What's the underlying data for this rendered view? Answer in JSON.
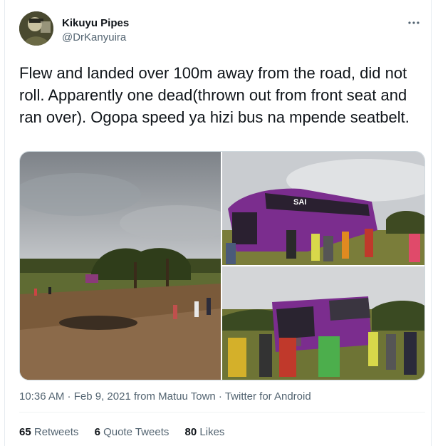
{
  "author": {
    "display_name": "Kikuyu Pipes",
    "handle": "@DrKanyuira"
  },
  "more_icon": "more-horizontal-icon",
  "tweet": {
    "text": "Flew and landed over 100m away from the road, did not roll. Apparently one dead(thrown out from front seat and ran over). Ogopa speed ya hizi bus na mpende seatbelt."
  },
  "photos": [
    {
      "id": "photo-1",
      "subject": "field scene with acacia trees and distant crowd"
    },
    {
      "id": "photo-2",
      "subject": "purple bus on its side with bystanders"
    },
    {
      "id": "photo-3",
      "subject": "purple bus front with crowd"
    }
  ],
  "meta": {
    "time": "10:36 AM",
    "dot1": " · ",
    "date": "Feb 9, 2021",
    "from_label": " from ",
    "location": "Matuu Town",
    "dot2": " · ",
    "source": "Twitter for Android"
  },
  "stats": {
    "retweets_count": "65",
    "retweets_label": "Retweets",
    "quotes_count": "6",
    "quotes_label": "Quote Tweets",
    "likes_count": "80",
    "likes_label": "Likes"
  },
  "colors": {
    "text_primary": "#0f1419",
    "text_secondary": "#536471",
    "border": "#cfd9de",
    "bus_purple": "#7b2d8e"
  }
}
